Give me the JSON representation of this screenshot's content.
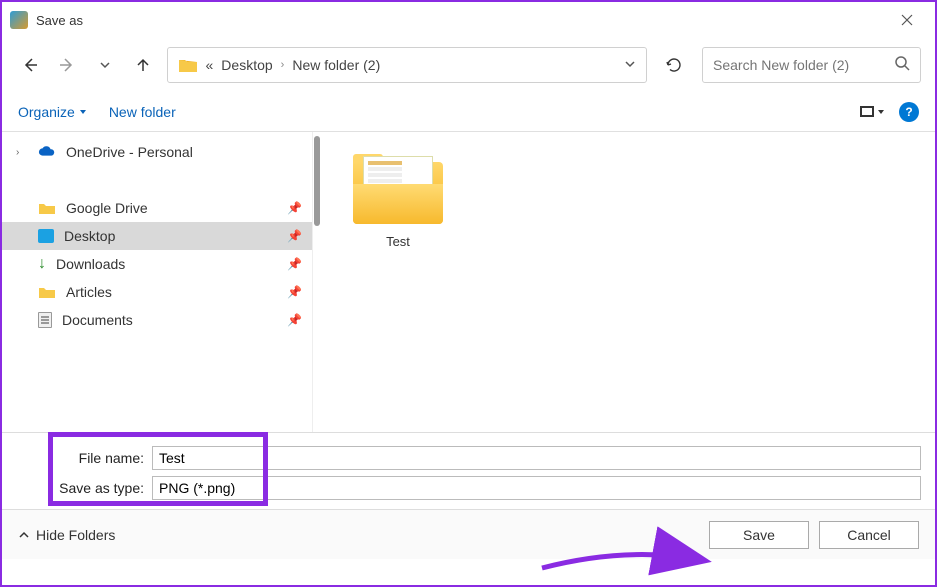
{
  "window": {
    "title": "Save as"
  },
  "nav": {
    "breadcrumb": {
      "prefix": "«",
      "p1": "Desktop",
      "p2": "New folder (2)"
    },
    "search_placeholder": "Search New folder (2)"
  },
  "toolbar": {
    "organize": "Organize",
    "newfolder": "New folder"
  },
  "sidebar": {
    "onedrive": "OneDrive - Personal",
    "items": [
      {
        "label": "Google Drive"
      },
      {
        "label": "Desktop"
      },
      {
        "label": "Downloads"
      },
      {
        "label": "Articles"
      },
      {
        "label": "Documents"
      }
    ]
  },
  "content": {
    "items": [
      {
        "name": "Test"
      }
    ]
  },
  "fields": {
    "filename_label": "File name:",
    "filename_value": "Test",
    "type_label": "Save as type:",
    "type_value": "PNG (*.png)"
  },
  "footer": {
    "hide": "Hide Folders",
    "save": "Save",
    "cancel": "Cancel"
  }
}
